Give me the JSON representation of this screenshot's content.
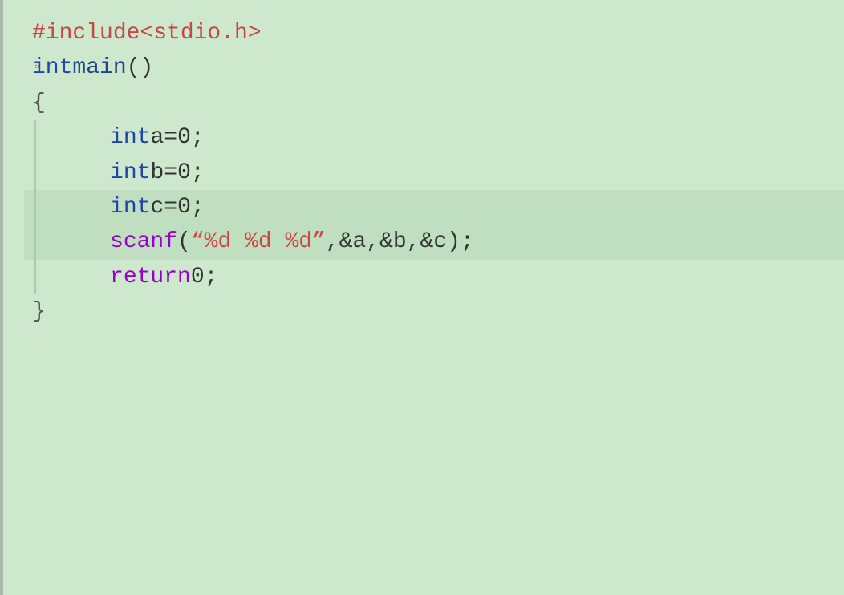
{
  "editor": {
    "background": "#cde8cd",
    "lines": [
      {
        "id": 1,
        "tokens": [
          {
            "type": "kw-include",
            "text": "#include"
          },
          {
            "type": "kw-plain",
            "text": " "
          },
          {
            "type": "kw-header",
            "text": "<stdio.h>"
          }
        ],
        "indent": 0,
        "collapse": false,
        "highlighted": false
      },
      {
        "id": 2,
        "tokens": [
          {
            "type": "kw-type",
            "text": "int"
          },
          {
            "type": "kw-plain",
            "text": " "
          },
          {
            "type": "kw-func",
            "text": "main"
          },
          {
            "type": "kw-paren",
            "text": "()"
          }
        ],
        "indent": 0,
        "collapse": true,
        "highlighted": false
      },
      {
        "id": 3,
        "tokens": [
          {
            "type": "kw-brace",
            "text": "{"
          }
        ],
        "indent": 0,
        "collapse": false,
        "highlighted": false
      },
      {
        "id": 4,
        "tokens": [
          {
            "type": "kw-type",
            "text": "int"
          },
          {
            "type": "kw-plain",
            "text": " "
          },
          {
            "type": "kw-var",
            "text": "a"
          },
          {
            "type": "kw-plain",
            "text": " "
          },
          {
            "type": "kw-op",
            "text": "="
          },
          {
            "type": "kw-plain",
            "text": " "
          },
          {
            "type": "kw-num",
            "text": "0"
          },
          {
            "type": "kw-semi",
            "text": ";"
          }
        ],
        "indent": 1,
        "collapse": false,
        "highlighted": false
      },
      {
        "id": 5,
        "tokens": [
          {
            "type": "kw-type",
            "text": "int"
          },
          {
            "type": "kw-plain",
            "text": " "
          },
          {
            "type": "kw-var",
            "text": "b"
          },
          {
            "type": "kw-plain",
            "text": " "
          },
          {
            "type": "kw-op",
            "text": "="
          },
          {
            "type": "kw-plain",
            "text": " "
          },
          {
            "type": "kw-num",
            "text": "0"
          },
          {
            "type": "kw-semi",
            "text": ";"
          }
        ],
        "indent": 1,
        "collapse": false,
        "highlighted": false
      },
      {
        "id": 6,
        "tokens": [
          {
            "type": "kw-type",
            "text": "int"
          },
          {
            "type": "kw-plain",
            "text": " "
          },
          {
            "type": "kw-var",
            "text": "c"
          },
          {
            "type": "kw-plain",
            "text": " "
          },
          {
            "type": "kw-op",
            "text": "="
          },
          {
            "type": "kw-plain",
            "text": " "
          },
          {
            "type": "kw-num",
            "text": "0"
          },
          {
            "type": "kw-semi",
            "text": ";"
          }
        ],
        "indent": 1,
        "collapse": false,
        "highlighted": true
      },
      {
        "id": 7,
        "tokens": [
          {
            "type": "kw-scanf",
            "text": "scanf"
          },
          {
            "type": "kw-paren",
            "text": "("
          },
          {
            "type": "kw-string",
            "text": "“%d %d %d”"
          },
          {
            "type": "kw-comma",
            "text": ","
          },
          {
            "type": "kw-plain",
            "text": " "
          },
          {
            "type": "kw-amp",
            "text": "&a"
          },
          {
            "type": "kw-comma",
            "text": ","
          },
          {
            "type": "kw-plain",
            "text": " "
          },
          {
            "type": "kw-amp",
            "text": "&b"
          },
          {
            "type": "kw-comma",
            "text": ","
          },
          {
            "type": "kw-plain",
            "text": " "
          },
          {
            "type": "kw-amp",
            "text": "&c"
          },
          {
            "type": "kw-paren",
            "text": ")"
          },
          {
            "type": "kw-semi",
            "text": ";"
          }
        ],
        "indent": 1,
        "collapse": false,
        "highlighted": true
      },
      {
        "id": 8,
        "tokens": [
          {
            "type": "kw-return",
            "text": "return"
          },
          {
            "type": "kw-plain",
            "text": " "
          },
          {
            "type": "kw-num",
            "text": "0"
          },
          {
            "type": "kw-semi",
            "text": ";"
          }
        ],
        "indent": 1,
        "collapse": false,
        "highlighted": false
      },
      {
        "id": 9,
        "tokens": [
          {
            "type": "kw-brace",
            "text": "}"
          }
        ],
        "indent": 0,
        "collapse": false,
        "highlighted": false
      }
    ]
  }
}
